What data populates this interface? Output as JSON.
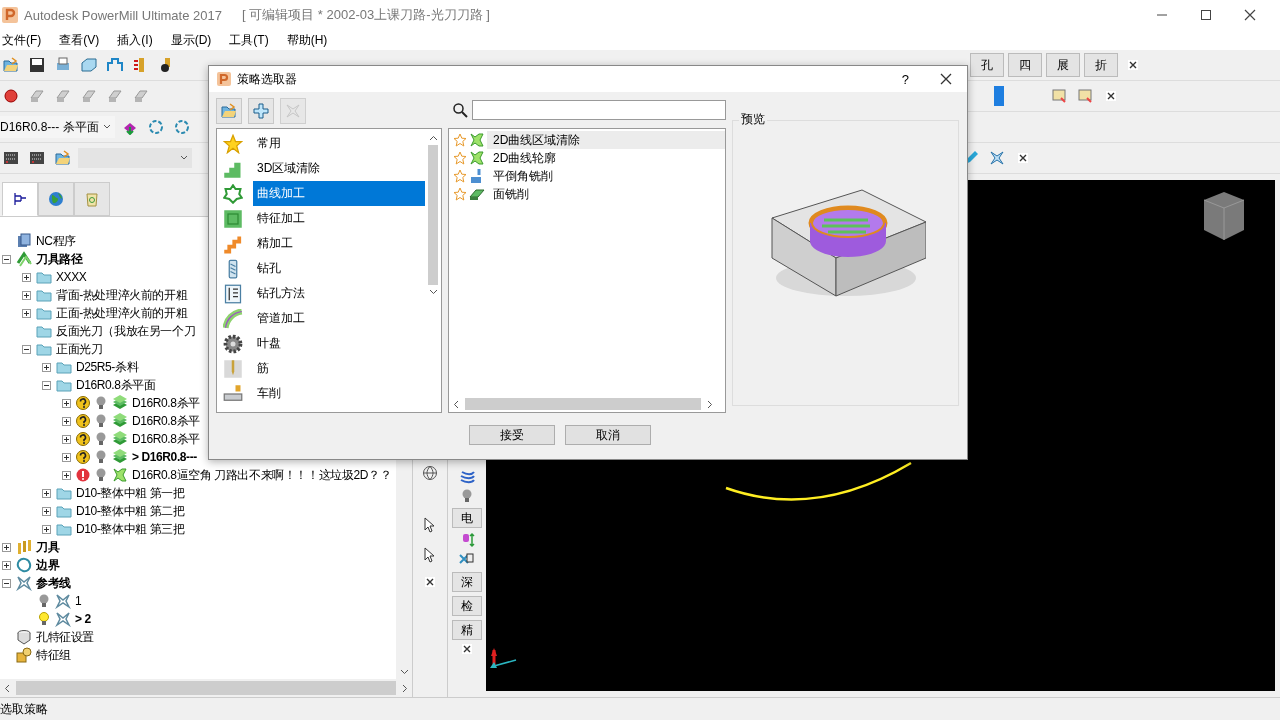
{
  "window": {
    "title": "Autodesk PowerMill Ultimate 2017",
    "project": "[ 可编辑项目 * 2002-03上课刀路-光刀刀路 ]"
  },
  "menu": [
    "文件(F)",
    "查看(V)",
    "插入(I)",
    "显示(D)",
    "工具(T)",
    "帮助(H)"
  ],
  "toolbar": {
    "tool_combo": {
      "value": "D16R0.8--- 杀平面"
    },
    "right_buttons": [
      "孔",
      "四",
      "展",
      "折"
    ]
  },
  "explorer_tabs": [
    {
      "selected": true
    },
    {
      "selected": false
    },
    {
      "selected": false
    }
  ],
  "tree": [
    {
      "label": "NC程序",
      "kind": "nc"
    },
    {
      "label": "刀具路径",
      "kind": "toolpaths",
      "bold": true,
      "expanded": true,
      "children": [
        {
          "label": "XXXX",
          "kind": "folder",
          "expanded": false
        },
        {
          "label": "背面-热处理淬火前的开粗",
          "kind": "folder",
          "expanded": false
        },
        {
          "label": "正面-热处理淬火前的开粗",
          "kind": "folder",
          "expanded": false
        },
        {
          "label": "反面光刀（我放在另一个刀",
          "kind": "folder"
        },
        {
          "label": "正面光刀",
          "kind": "folder",
          "expanded": true,
          "children": [
            {
              "label": "D25R5-杀料",
              "kind": "folder",
              "expanded": false
            },
            {
              "label": "D16R0.8杀平面",
              "kind": "folder",
              "expanded": true,
              "children": [
                {
                  "label": "D16R0.8杀平",
                  "kind": "toolpath",
                  "error": false,
                  "light": false,
                  "expanded": false
                },
                {
                  "label": "D16R0.8杀平",
                  "kind": "toolpath",
                  "error": false,
                  "light": false,
                  "expanded": false
                },
                {
                  "label": "D16R0.8杀平",
                  "kind": "toolpath",
                  "error": false,
                  "light": false,
                  "expanded": false
                },
                {
                  "label": "> D16R0.8---",
                  "kind": "toolpath",
                  "error": false,
                  "light": false,
                  "bold": true,
                  "expanded": false
                },
                {
                  "label": "D16R0.8逼空角 刀路出不来啊！！！这垃圾2D？？",
                  "kind": "curve-toolpath",
                  "error": true,
                  "light": false,
                  "expanded": false
                }
              ]
            },
            {
              "label": "D10-整体中粗  第一把",
              "kind": "folder",
              "expanded": false
            },
            {
              "label": "D10-整体中粗  第二把",
              "kind": "folder",
              "expanded": false
            },
            {
              "label": "D10-整体中粗  第三把",
              "kind": "folder",
              "expanded": false
            }
          ]
        }
      ]
    },
    {
      "label": "刀具",
      "kind": "tools",
      "bold": true,
      "expanded": false
    },
    {
      "label": "边界",
      "kind": "boundary",
      "bold": true,
      "expanded": false
    },
    {
      "label": "参考线",
      "kind": "pattern",
      "bold": true,
      "expanded": true,
      "children": [
        {
          "label": "1",
          "kind": "pattern-item",
          "light": false
        },
        {
          "label": "> 2",
          "kind": "pattern-item",
          "light": true,
          "bold": true
        }
      ]
    },
    {
      "label": "孔特征设置",
      "kind": "hole"
    },
    {
      "label": "特征组",
      "kind": "feature"
    }
  ],
  "side_toolbar": [
    {
      "kind": "icon"
    },
    {
      "kind": "icon"
    },
    {
      "kind": "button",
      "label": "电"
    },
    {
      "kind": "icon"
    },
    {
      "kind": "icon"
    },
    {
      "kind": "button",
      "label": "深"
    },
    {
      "kind": "button",
      "label": "检"
    },
    {
      "kind": "button",
      "label": "精"
    },
    {
      "kind": "close"
    }
  ],
  "dialog": {
    "title": "策略选取器",
    "help": "?",
    "categories": [
      {
        "label": "常用",
        "selected": false
      },
      {
        "label": "3D区域清除",
        "selected": false
      },
      {
        "label": "曲线加工",
        "selected": true
      },
      {
        "label": "特征加工",
        "selected": false
      },
      {
        "label": "精加工",
        "selected": false
      },
      {
        "label": "钻孔",
        "selected": false
      },
      {
        "label": "钻孔方法",
        "selected": false
      },
      {
        "label": "管道加工",
        "selected": false
      },
      {
        "label": "叶盘",
        "selected": false
      },
      {
        "label": "筋",
        "selected": false
      },
      {
        "label": "车削",
        "selected": false
      }
    ],
    "strategies": [
      {
        "label": "2D曲线区域清除",
        "selected": true,
        "favorite": false
      },
      {
        "label": "2D曲线轮廓",
        "selected": false,
        "favorite": false
      },
      {
        "label": "平倒角铣削",
        "selected": false,
        "favorite": false
      },
      {
        "label": "面铣削",
        "selected": false,
        "favorite": false
      }
    ],
    "preview_label": "预览",
    "buttons": [
      "接受",
      "取消"
    ]
  },
  "status_bar": "选取策略"
}
